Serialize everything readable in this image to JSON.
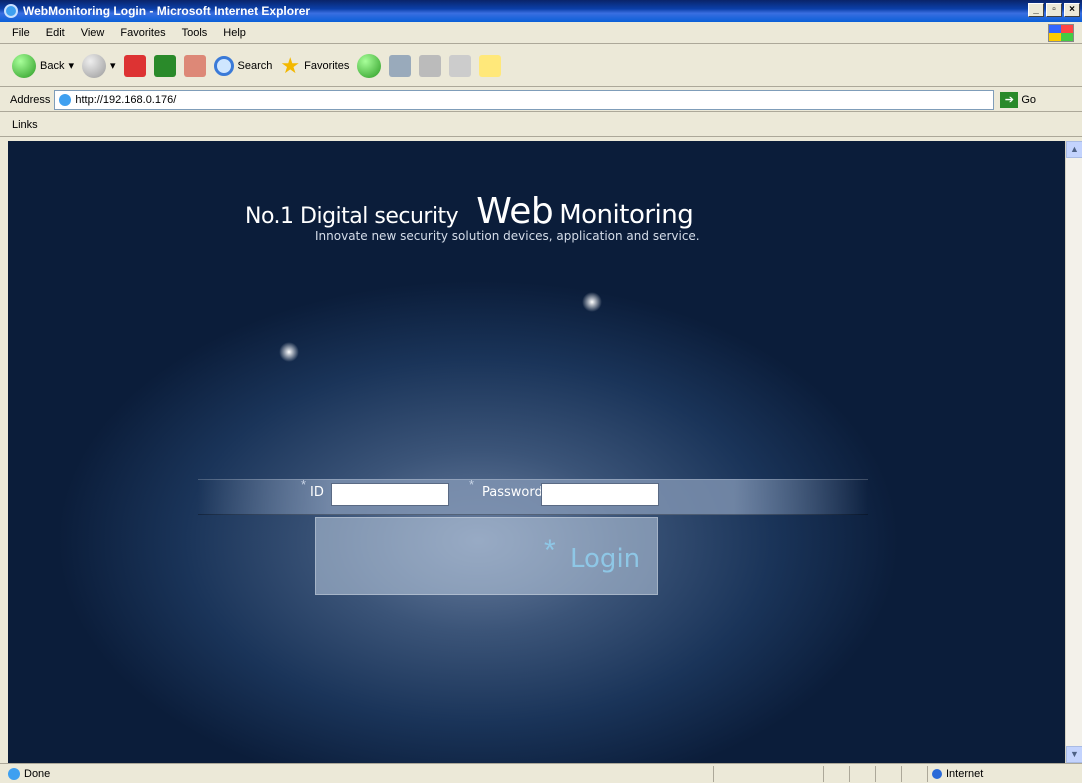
{
  "window": {
    "title": "WebMonitoring Login - Microsoft Internet Explorer"
  },
  "menu": {
    "items": [
      "File",
      "Edit",
      "View",
      "Favorites",
      "Tools",
      "Help"
    ]
  },
  "toolbar": {
    "back": "Back",
    "search": "Search",
    "favorites": "Favorites"
  },
  "address": {
    "label": "Address",
    "url": "http://192.168.0.176/",
    "go": "Go"
  },
  "links": {
    "label": "Links"
  },
  "page": {
    "headline_prefix": "No.1 Digital security",
    "headline_big": "Web",
    "headline_suffix": "Monitoring",
    "subtitle": "Innovate new security solution devices, application and service.",
    "id_label": "ID",
    "id_value": "",
    "password_label": "Password",
    "password_value": "",
    "login_label": "Login"
  },
  "status": {
    "text": "Done",
    "zone": "Internet"
  },
  "icons": [
    "ie-icon",
    "back-icon",
    "forward-icon",
    "stop-icon",
    "refresh-icon",
    "home-icon",
    "search-icon",
    "favorites-icon",
    "history-icon",
    "mail-icon",
    "print-icon",
    "edit-icon",
    "messenger-icon",
    "globe-icon"
  ]
}
